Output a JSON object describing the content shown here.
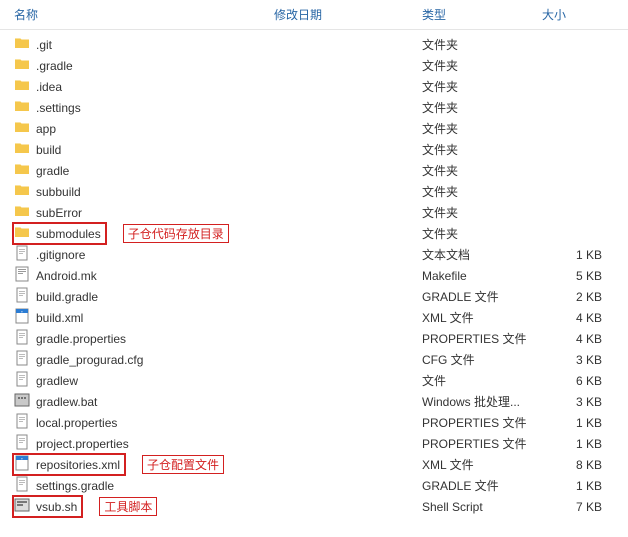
{
  "header": {
    "name": "名称",
    "date": "修改日期",
    "type": "类型",
    "size": "大小"
  },
  "rows": [
    {
      "icon": "folder",
      "name": ".git",
      "type": "文件夹",
      "size": ""
    },
    {
      "icon": "folder",
      "name": ".gradle",
      "type": "文件夹",
      "size": ""
    },
    {
      "icon": "folder",
      "name": ".idea",
      "type": "文件夹",
      "size": ""
    },
    {
      "icon": "folder",
      "name": ".settings",
      "type": "文件夹",
      "size": ""
    },
    {
      "icon": "folder",
      "name": "app",
      "type": "文件夹",
      "size": ""
    },
    {
      "icon": "folder",
      "name": "build",
      "type": "文件夹",
      "size": ""
    },
    {
      "icon": "folder",
      "name": "gradle",
      "type": "文件夹",
      "size": ""
    },
    {
      "icon": "folder",
      "name": "subbuild",
      "type": "文件夹",
      "size": ""
    },
    {
      "icon": "folder",
      "name": "subError",
      "type": "文件夹",
      "size": ""
    },
    {
      "icon": "folder",
      "name": "submodules",
      "type": "文件夹",
      "size": "",
      "highlight": true,
      "annotation": "子仓代码存放目录"
    },
    {
      "icon": "text",
      "name": ".gitignore",
      "type": "文本文档",
      "size": "1 KB"
    },
    {
      "icon": "make",
      "name": "Android.mk",
      "type": "Makefile",
      "size": "5 KB"
    },
    {
      "icon": "text",
      "name": "build.gradle",
      "type": "GRADLE 文件",
      "size": "2 KB"
    },
    {
      "icon": "xml",
      "name": "build.xml",
      "type": "XML 文件",
      "size": "4 KB"
    },
    {
      "icon": "text",
      "name": "gradle.properties",
      "type": "PROPERTIES 文件",
      "size": "4 KB"
    },
    {
      "icon": "text",
      "name": "gradle_progurad.cfg",
      "type": "CFG 文件",
      "size": "3 KB"
    },
    {
      "icon": "text",
      "name": "gradlew",
      "type": "文件",
      "size": "6 KB"
    },
    {
      "icon": "bat",
      "name": "gradlew.bat",
      "type": "Windows 批处理...",
      "size": "3 KB"
    },
    {
      "icon": "text",
      "name": "local.properties",
      "type": "PROPERTIES 文件",
      "size": "1 KB"
    },
    {
      "icon": "text",
      "name": "project.properties",
      "type": "PROPERTIES 文件",
      "size": "1 KB"
    },
    {
      "icon": "xml",
      "name": "repositories.xml",
      "type": "XML 文件",
      "size": "8 KB",
      "highlight": true,
      "annotation": "子仓配置文件"
    },
    {
      "icon": "text",
      "name": "settings.gradle",
      "type": "GRADLE 文件",
      "size": "1 KB"
    },
    {
      "icon": "sh",
      "name": "vsub.sh",
      "type": "Shell Script",
      "size": "7 KB",
      "highlight": true,
      "annotation": "工具脚本"
    }
  ]
}
